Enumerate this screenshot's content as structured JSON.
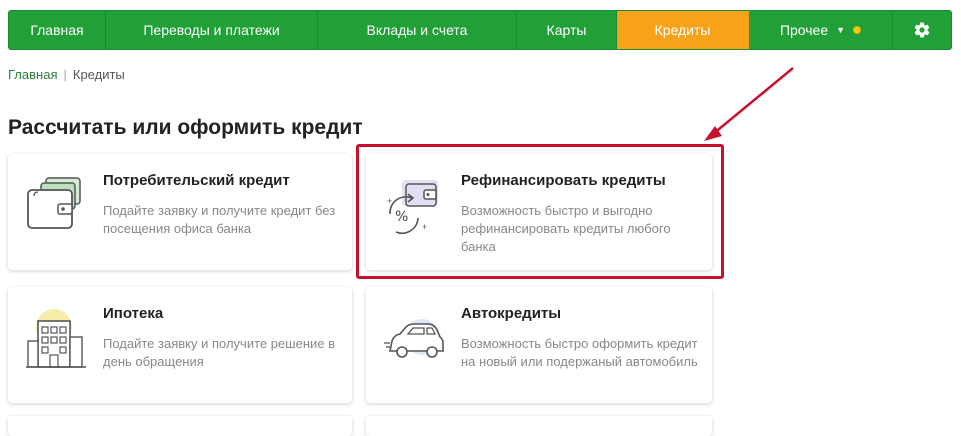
{
  "nav": {
    "items": [
      {
        "label": "Главная"
      },
      {
        "label": "Переводы и платежи"
      },
      {
        "label": "Вклады и счета"
      },
      {
        "label": "Карты"
      },
      {
        "label": "Кредиты",
        "active": true
      },
      {
        "label": "Прочее"
      }
    ],
    "settings_icon": "gear-icon"
  },
  "breadcrumb": {
    "home": "Главная",
    "current": "Кредиты"
  },
  "page_title": "Рассчитать или оформить кредит",
  "cards": [
    {
      "title": "Потребительский кредит",
      "desc": "Подайте заявку и получите кредит без посещения офиса банка",
      "icon": "wallet-cash-icon"
    },
    {
      "title": "Рефинансировать кредиты",
      "desc": "Возможность быстро и выгодно рефинансировать кредиты любого банка",
      "icon": "refinance-percent-icon"
    },
    {
      "title": "Ипотека",
      "desc": "Подайте заявку и получите решение в день обращения",
      "icon": "building-icon"
    },
    {
      "title": "Автокредиты",
      "desc": "Возможность быстро оформить кредит на новый или подержаный автомобиль",
      "icon": "car-icon"
    }
  ],
  "colors": {
    "nav_green": "#21a038",
    "nav_active": "#f7a21b",
    "highlight_red": "#c8102e"
  }
}
